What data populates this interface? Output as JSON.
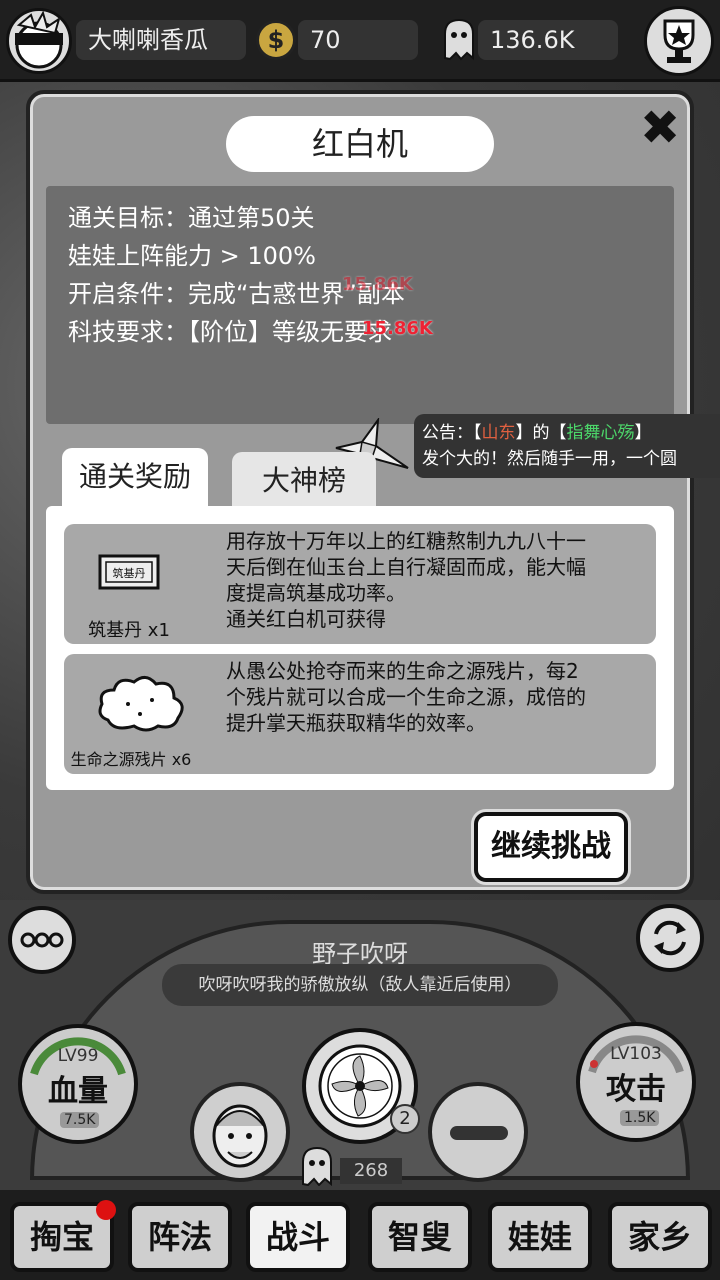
{
  "topbar": {
    "player_name": "大喇喇香瓜",
    "coins": "70",
    "souls": "136.6K"
  },
  "dialog": {
    "title": "红白机",
    "info_lines": [
      "通关目标：通过第50关",
      "娃娃上阵能力 > 100%",
      "开启条件：完成“古惑世界”副本",
      "科技要求：【阶位】等级无要求"
    ],
    "floating_numbers": [
      "15.86K",
      "15.86K"
    ],
    "tabs": [
      {
        "label": "通关奖励",
        "active": true
      },
      {
        "label": "大神榜",
        "active": false
      }
    ],
    "rewards": [
      {
        "name": "筑基丹 x1",
        "icon": "pill-box-icon",
        "box_text": "筑基丹",
        "description": "用存放十万年以上的红糖熬制九九八十一\n天后倒在仙玉台上自行凝固而成，能大幅\n度提高筑基成功率。\n通关红白机可获得"
      },
      {
        "name": "生命之源残片 x6",
        "icon": "cloud-fragment-icon",
        "description": "从愚公处抢夺而来的生命之源残片，每2\n个残片就可以合成一个生命之源，成倍的\n提升掌天瓶获取精华的效率。"
      }
    ],
    "continue_label": "继续挑战"
  },
  "notice": {
    "prefix": "公告：【",
    "province": "山东",
    "mid": "】的【",
    "player": "指舞心殇",
    "suffix": "】",
    "line2": "发个大的！然后随手一用，一个圆"
  },
  "battle": {
    "character_name": "野子吹呀",
    "skill_desc": "吹呀吹呀我的骄傲放纵（敌人靠近后使用）",
    "hp": {
      "level": "LV99",
      "label": "血量",
      "cost": "7.5K"
    },
    "atk": {
      "level": "LV103",
      "label": "攻击",
      "cost": "1.5K"
    },
    "skill_badge": "2",
    "soul_count": "268"
  },
  "nav": [
    "掏宝",
    "阵法",
    "战斗",
    "智叟",
    "娃娃",
    "家乡"
  ],
  "nav_active": "战斗"
}
